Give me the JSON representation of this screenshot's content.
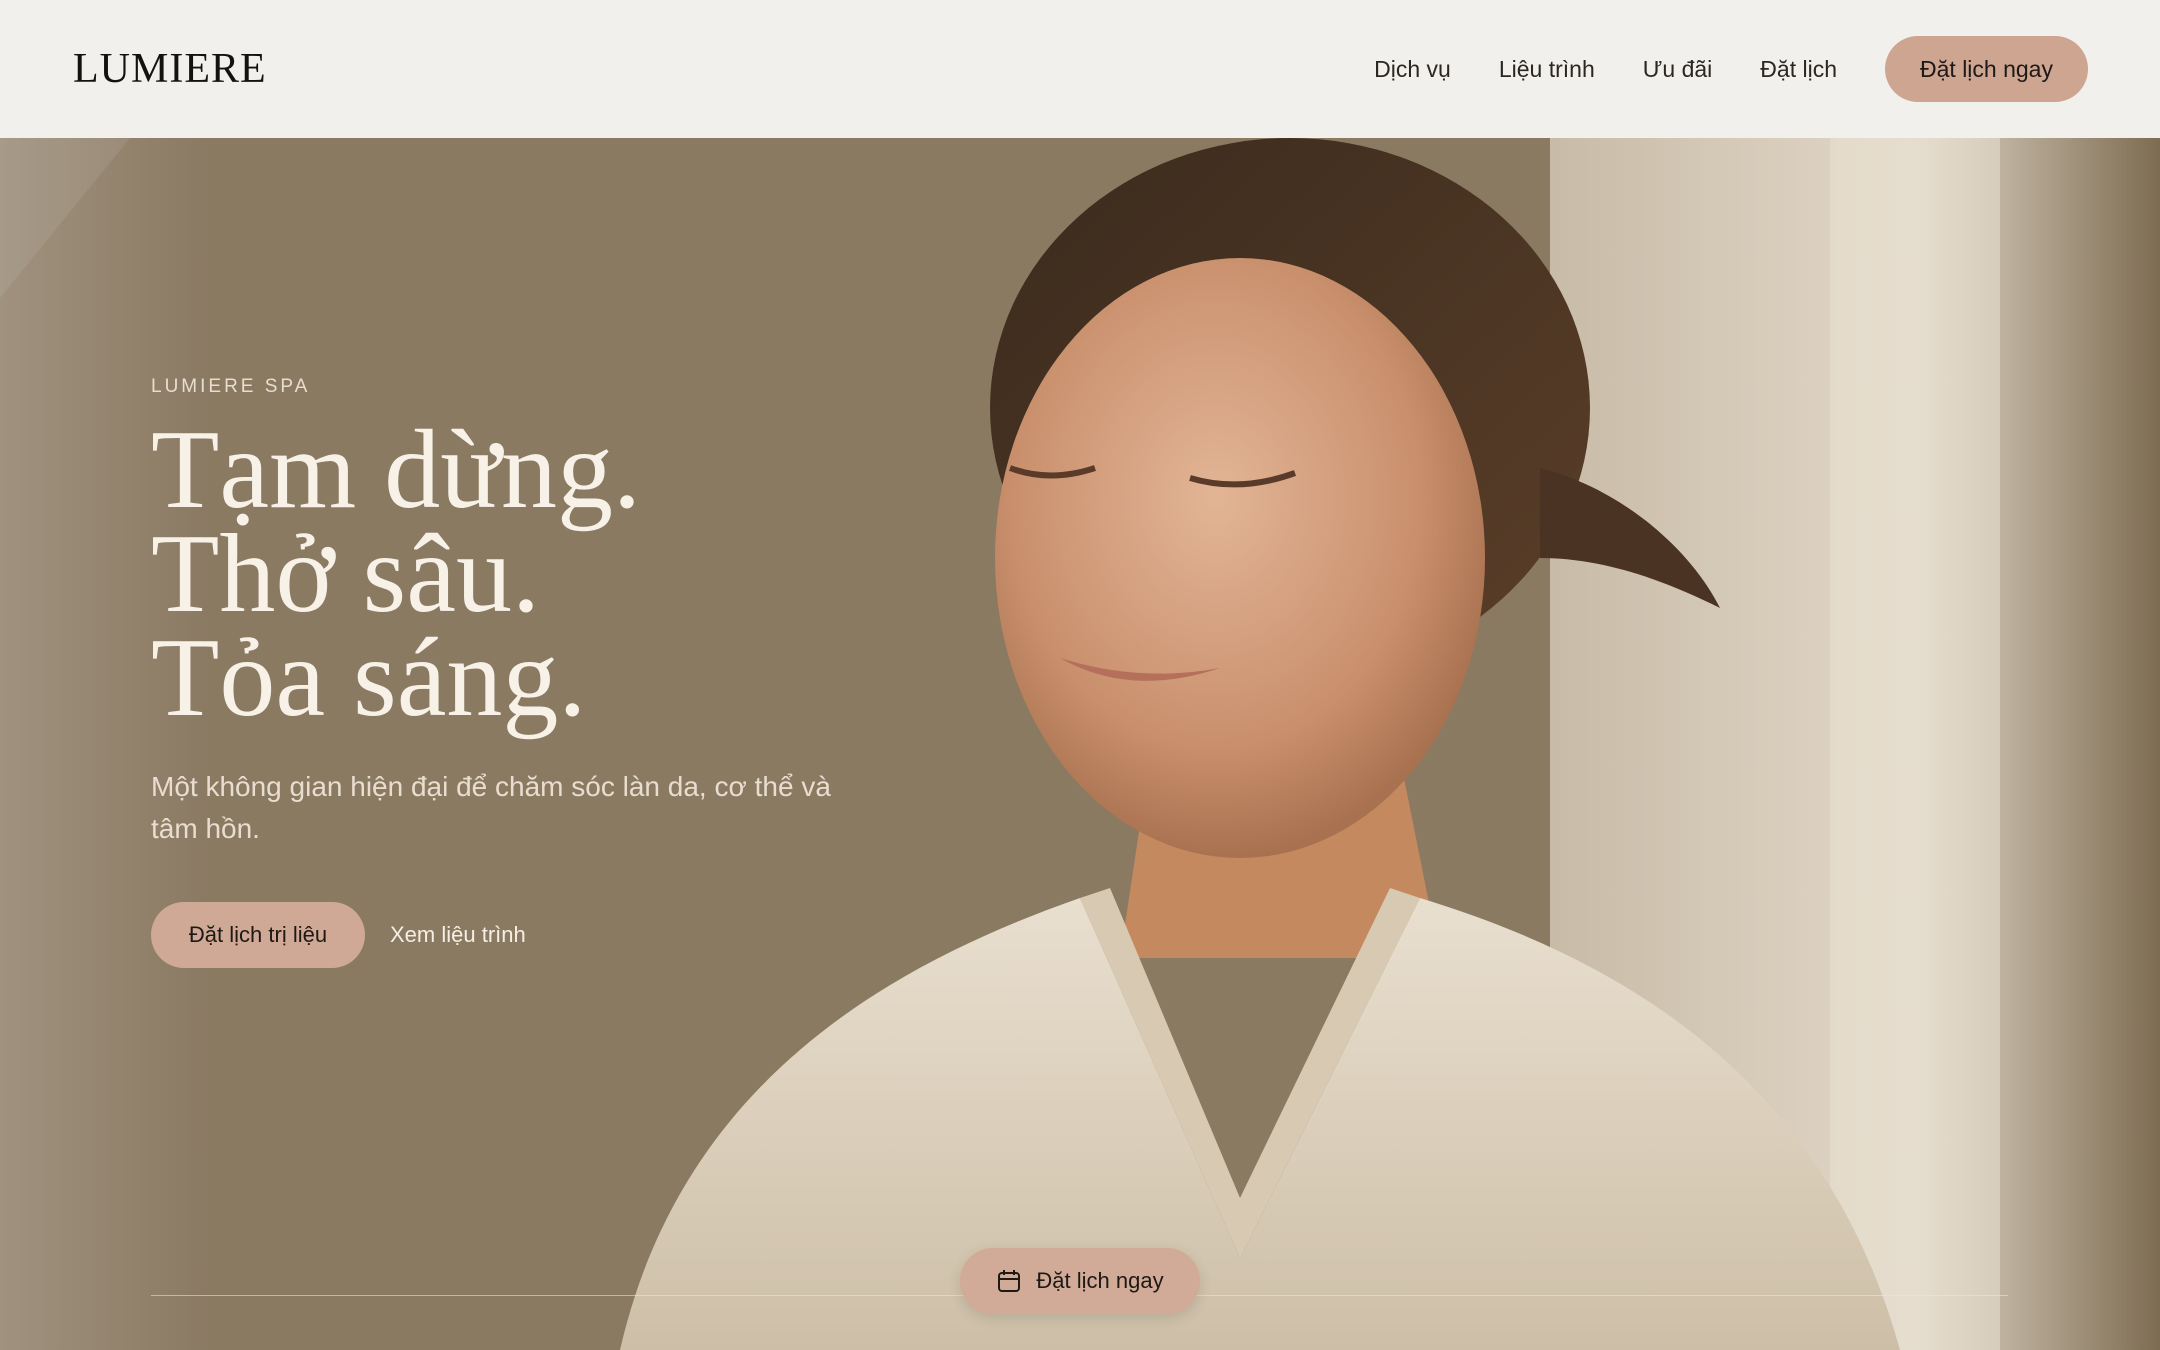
{
  "header": {
    "logo": "LUMIERE",
    "nav": [
      "Dịch vụ",
      "Liệu trình",
      "Ưu đãi",
      "Đặt lịch"
    ],
    "cta_label": "Đặt lịch ngay"
  },
  "hero": {
    "eyebrow": "LUMIERE SPA",
    "headline": [
      "Tạm dừng.",
      "Thở sâu.",
      "Tỏa sáng."
    ],
    "subtitle": "Một không gian hiện đại để chăm sóc làn da, cơ thể và tâm hồn.",
    "primary_cta": "Đặt lịch trị liệu",
    "secondary_cta": "Xem liệu trình",
    "photo_icon": "woman-in-robe-photo"
  },
  "floating_cta": {
    "label": "Đặt lịch ngay",
    "icon": "calendar-icon"
  },
  "colors": {
    "accent": "#cda591",
    "header_bg": "#f1f0ec"
  }
}
